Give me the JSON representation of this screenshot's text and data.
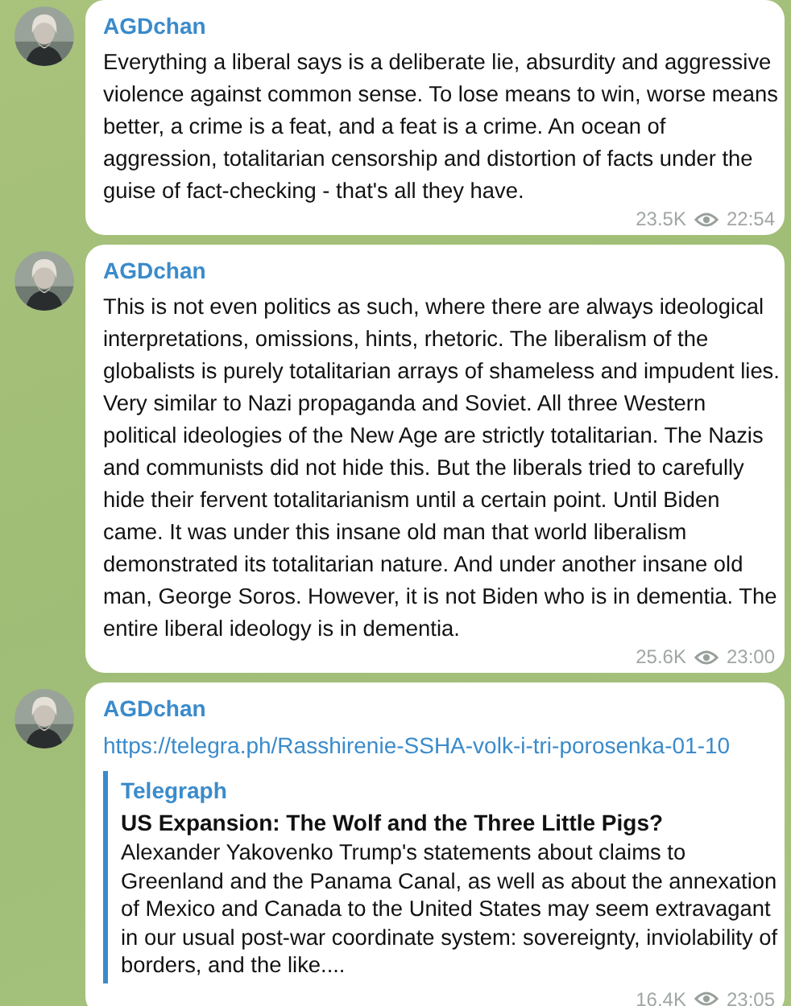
{
  "messages": [
    {
      "author": "AGDchan",
      "text": "Everything a liberal says is a deliberate lie, absurdity and aggressive violence against common sense. To lose means to win, worse means better, a crime is a feat, and a feat is a crime. An ocean of aggression, totalitarian censorship and distortion of facts under the guise of fact-checking - that's all they have.",
      "views": "23.5K",
      "time": "22:54"
    },
    {
      "author": "AGDchan",
      "text": "This is not even politics as such, where there are always ideological interpretations, omissions, hints, rhetoric. The liberalism of the globalists is purely totalitarian arrays of shameless and impudent lies. Very similar to Nazi propaganda and Soviet. All three Western political ideologies of the New Age are strictly totalitarian. The Nazis and communists did not hide this. But the liberals tried to carefully hide their fervent totalitarianism until a certain point. Until Biden came. It was under this insane old man that world liberalism demonstrated its totalitarian nature. And under another insane old man, George Soros. However, it is not Biden who is in dementia. The entire liberal ideology is in dementia.",
      "views": "25.6K",
      "time": "23:00"
    },
    {
      "author": "AGDchan",
      "link": "https://telegra.ph/Rasshirenie-SSHA-volk-i-tri-porosenka-01-10",
      "preview": {
        "site": "Telegraph",
        "title": "US Expansion: The Wolf and the Three Little Pigs?",
        "description": "Alexander Yakovenko Trump's statements about claims to Greenland and the Panama Canal, as well as about the annexation of Mexico and Canada to the United States may seem extravagant in our usual post-war coordinate system: sovereignty, inviolability of borders, and the like...."
      },
      "views": "16.4K",
      "time": "23:05"
    }
  ]
}
